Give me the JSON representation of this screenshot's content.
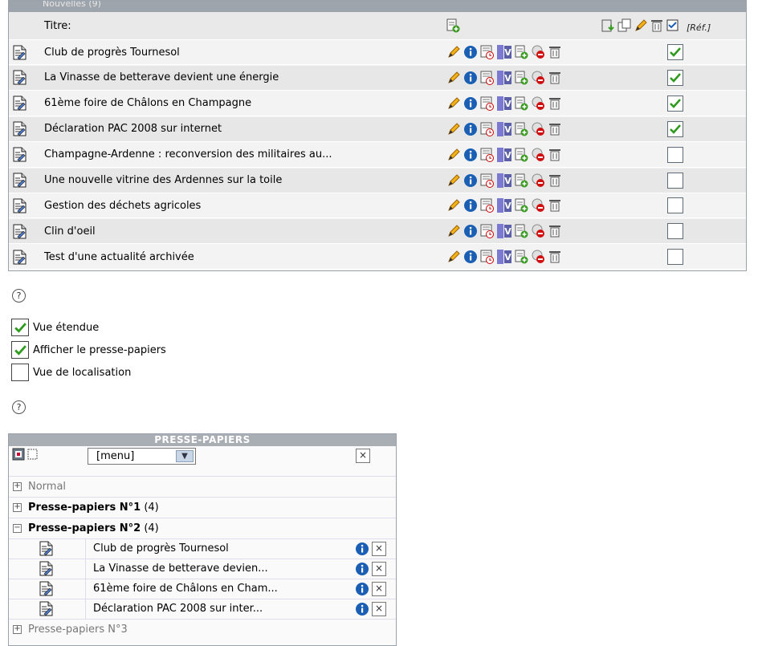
{
  "panel": {
    "header_title": "Nouvelles (9)",
    "title_column": "Titre:",
    "ref_label": "[Réf.]",
    "rows": [
      {
        "title": "Club de progrès Tournesol",
        "checked": true
      },
      {
        "title": "La Vinasse de betterave devient une énergie",
        "checked": true
      },
      {
        "title": "61ème foire de Châlons en Champagne",
        "checked": true
      },
      {
        "title": "Déclaration PAC 2008 sur internet",
        "checked": true
      },
      {
        "title": "Champagne-Ardenne : reconversion des militaires au...",
        "checked": false
      },
      {
        "title": "Une nouvelle vitrine des Ardennes sur la toile",
        "checked": false
      },
      {
        "title": "Gestion des déchets agricoles",
        "checked": false
      },
      {
        "title": "Clin d'oeil",
        "checked": false
      },
      {
        "title": "Test d'une actualité archivée",
        "checked": false
      }
    ]
  },
  "help_label": "?",
  "options": [
    {
      "label": "Vue étendue",
      "checked": true
    },
    {
      "label": "Afficher le presse-papiers",
      "checked": true
    },
    {
      "label": "Vue de localisation",
      "checked": false
    }
  ],
  "clipboard": {
    "title": "PRESSE-PAPIERS",
    "menu_label": "[menu]",
    "close_label": "×",
    "groups": [
      {
        "label": "Normal",
        "count": "",
        "expanded": false,
        "bold": false
      },
      {
        "label": "Presse-papiers N°1",
        "count": "(4)",
        "expanded": false,
        "bold": true
      },
      {
        "label": "Presse-papiers N°2",
        "count": "(4)",
        "expanded": true,
        "bold": true
      },
      {
        "label": "Presse-papiers N°3",
        "count": "",
        "expanded": false,
        "bold": false
      }
    ],
    "items": [
      "Club de progrès Tournesol",
      "La Vinasse de betterave devien...",
      "61ème foire de Châlons en Cham...",
      "Déclaration PAC 2008 sur inter..."
    ]
  },
  "colors": {
    "check_green": "#2e9b1e",
    "info_blue": "#1a5fb4",
    "pencil_orange": "#e08a00",
    "delete_red": "#d01010"
  }
}
